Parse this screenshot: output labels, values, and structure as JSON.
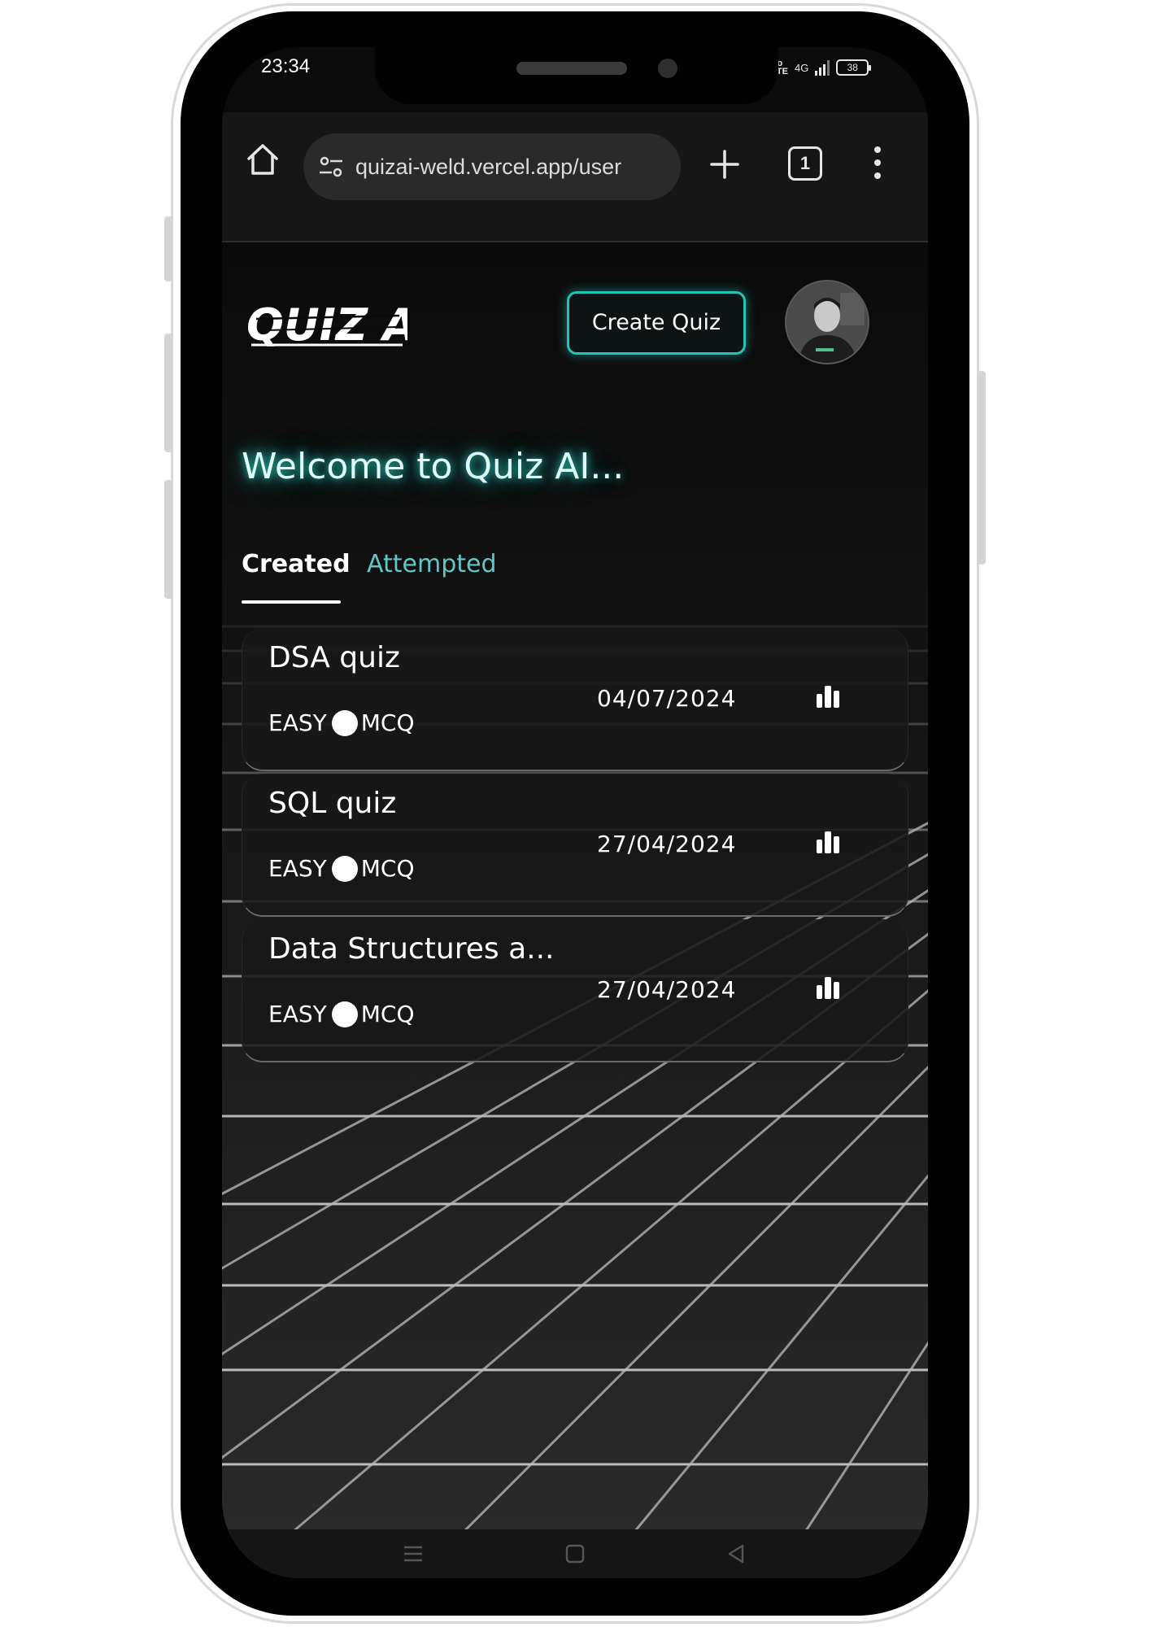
{
  "status_bar": {
    "time": "23:34",
    "network": "4G",
    "battery": "38"
  },
  "browser": {
    "url": "quizai-weld.vercel.app/user",
    "tab_count": "1"
  },
  "header": {
    "logo_text": "QUIZ AI",
    "create_button_label": "Create Quiz"
  },
  "welcome_text": "Welcome to Quiz AI...",
  "tabs": [
    {
      "label": "Created",
      "active": true
    },
    {
      "label": "Attempted",
      "active": false
    }
  ],
  "quizzes": [
    {
      "title": "DSA quiz",
      "difficulty": "EASY",
      "type": "MCQ",
      "date": "04/07/2024"
    },
    {
      "title": "SQL quiz",
      "difficulty": "EASY",
      "type": "MCQ",
      "date": "27/04/2024"
    },
    {
      "title": "Data Structures a...",
      "difficulty": "EASY",
      "type": "MCQ",
      "date": "27/04/2024"
    }
  ],
  "colors": {
    "accent": "#22c4b6",
    "tab_inactive": "#63c6c4",
    "background": "#0a0a0a"
  },
  "icons": [
    "home-icon",
    "site-settings-icon",
    "plus-icon",
    "tabs-icon",
    "more-menu-icon",
    "stats-icon",
    "nav-menu-icon",
    "nav-home-icon",
    "nav-back-icon"
  ]
}
